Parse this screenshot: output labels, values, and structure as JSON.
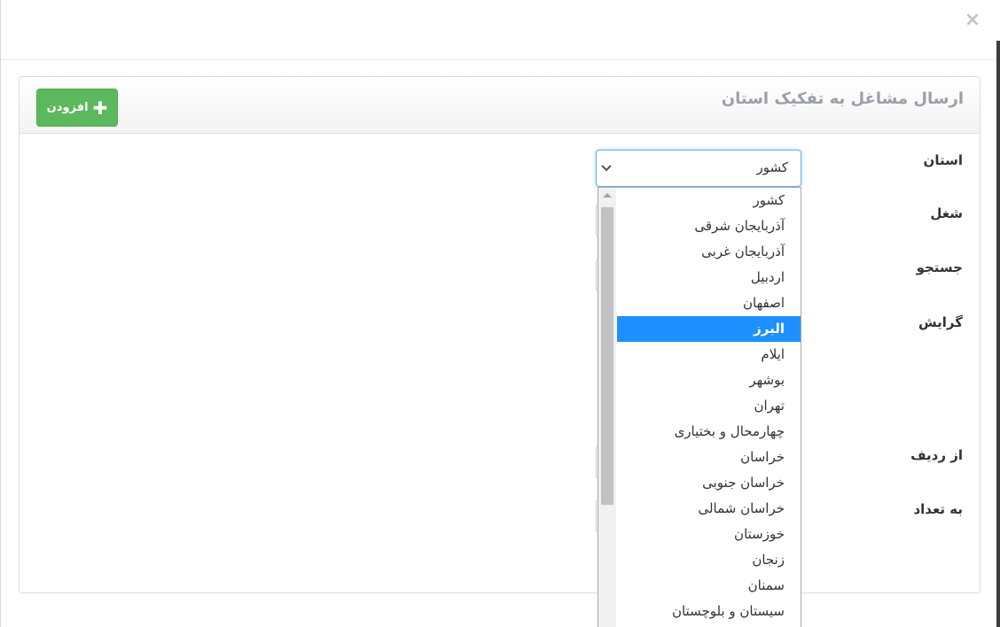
{
  "dialog": {
    "close_symbol": "×"
  },
  "panel": {
    "title": "ارسال مشاغل به تفکیک استان",
    "add_button": {
      "label": "افزودن",
      "icon": "plus-icon"
    }
  },
  "form": {
    "labels": {
      "province": "استان",
      "job": "شغل",
      "search": "جستجو",
      "orientation": "گرایش",
      "from_row": "از ردیف",
      "count": "به تعداد"
    },
    "province_select": {
      "value": "کشور",
      "icon": "chevron-down-icon",
      "options": [
        "کشور",
        "آذربایجان شرقی",
        "آذربایجان غربی",
        "اردبیل",
        "اصفهان",
        "البرز",
        "ایلام",
        "بوشهر",
        "تهران",
        "چهارمحال و بختیاری",
        "خراسان",
        "خراسان جنوبی",
        "خراسان شمالی",
        "خوزستان",
        "زنجان",
        "سمنان",
        "سیستان و بلوچستان"
      ],
      "highlighted_option": "البرز"
    }
  },
  "colors": {
    "add_button": "#5cb85c",
    "highlight": "#1e90ff",
    "focus_border": "#66afe9"
  }
}
